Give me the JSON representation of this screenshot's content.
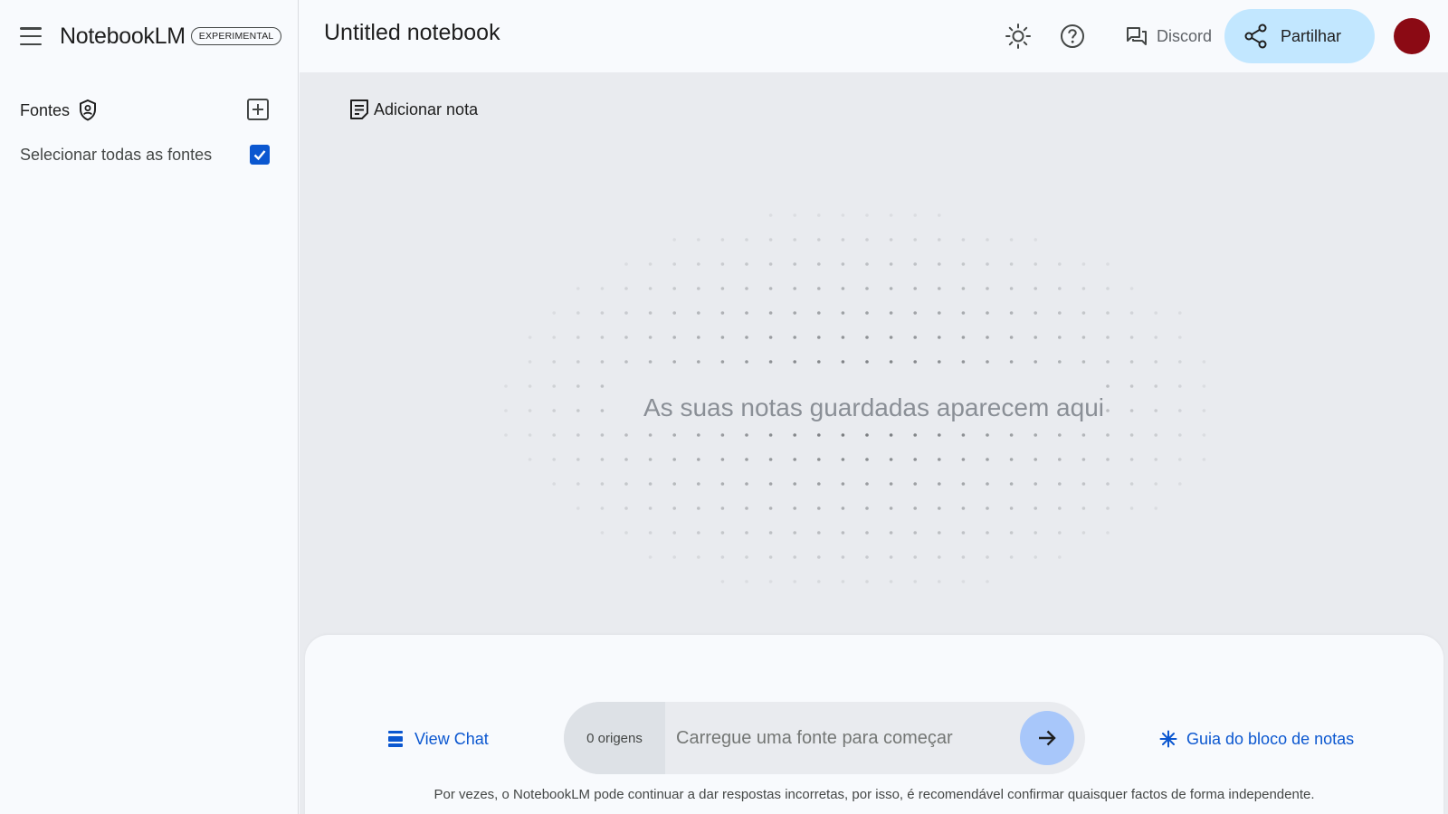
{
  "app": {
    "name": "NotebookLM",
    "badge": "EXPERIMENTAL"
  },
  "sidebar": {
    "sources_title": "Fontes",
    "select_all_label": "Selecionar todas as fontes",
    "select_all_checked": true,
    "icons": {
      "menu": "menu-icon",
      "sources": "shield-icon",
      "add_source": "add-box-icon"
    }
  },
  "header": {
    "notebook_title": "Untitled notebook",
    "discord_label": "Discord",
    "share_label": "Partilhar",
    "icons": {
      "theme": "sun-icon",
      "help": "help-icon",
      "discord": "forum-icon",
      "share": "share-icon"
    },
    "avatar_color": "#8b0a14"
  },
  "notes": {
    "add_note_label": "Adicionar nota",
    "empty_message": "As suas notas guardadas aparecem aqui"
  },
  "chat": {
    "view_chat_label": "View Chat",
    "origins_label": "0 origens",
    "input_placeholder": "Carregue uma fonte para começar",
    "input_value": "",
    "guide_label": "Guia do bloco de notas",
    "disclaimer": "Por vezes, o NotebookLM pode continuar a dar respostas incorretas, por isso, é recomendável confirmar quaisquer factos de forma independente."
  },
  "colors": {
    "accent": "#0b57d0",
    "share_bg": "#c2e7ff",
    "send_bg": "#a8c7fa",
    "notes_bg": "#e9ebef"
  }
}
